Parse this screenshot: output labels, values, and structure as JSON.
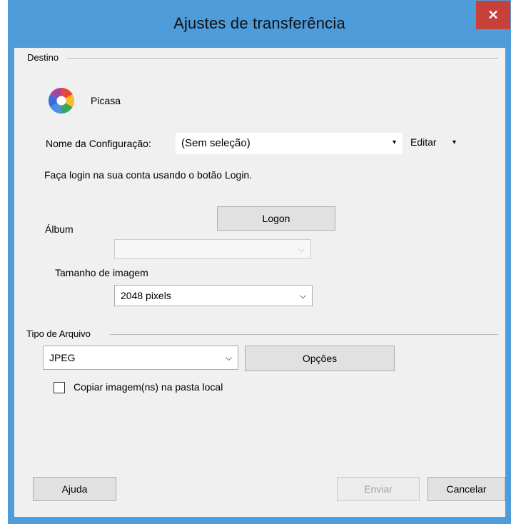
{
  "window": {
    "title": "Ajustes de transferência",
    "close_glyph": "✕"
  },
  "destination": {
    "group_label": "Destino",
    "service_icon": "picasa-logo-icon",
    "service_name": "Picasa",
    "config_label": "Nome da Configuração:",
    "config_value": "(Sem seleção)",
    "config_arrow": "▾",
    "edit_label": "Editar",
    "edit_arrow": "▾",
    "login_hint": "Faça login na sua conta usando o botão Login.",
    "logon_button": "Logon",
    "album_label": "Álbum",
    "album_value": "",
    "album_enabled": false,
    "image_size_label": "Tamanho de imagem",
    "image_size_value": "2048 pixels"
  },
  "file_type": {
    "group_label": "Tipo de Arquivo",
    "format_value": "JPEG",
    "options_button": "Opções",
    "copy_local_label": "Copiar imagem(ns) na pasta local",
    "copy_local_checked": false
  },
  "footer": {
    "help_button": "Ajuda",
    "send_button": "Enviar",
    "send_enabled": false,
    "cancel_button": "Cancelar"
  },
  "combo_arrow": "⌵",
  "colors": {
    "title_bar": "#4f9cda",
    "close_button": "#c7403a",
    "dialog_background": "#f0f0f0"
  }
}
